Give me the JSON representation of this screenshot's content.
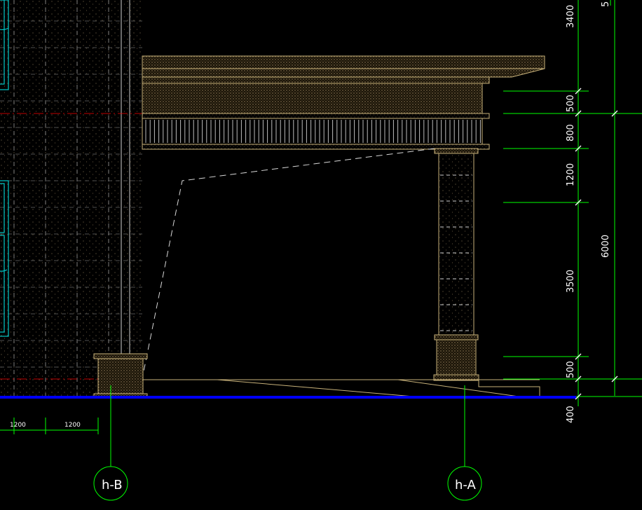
{
  "drawing": {
    "vertical_dims_right": [
      "3400",
      "500",
      "800",
      "1200",
      "3500",
      "500",
      "400"
    ],
    "overall_dim": "6000",
    "top_edge_dim": "5",
    "bottom_dims_left": [
      "1200",
      "1200"
    ],
    "axis_bubbles": [
      "h-B",
      "h-A"
    ]
  },
  "colors": {
    "background": "#000000",
    "dim_lines": "#00ff00",
    "outline": "#c8b27a",
    "ground": "#0000ff",
    "window": "#00c8c8",
    "axis_red": "#ff0000"
  }
}
